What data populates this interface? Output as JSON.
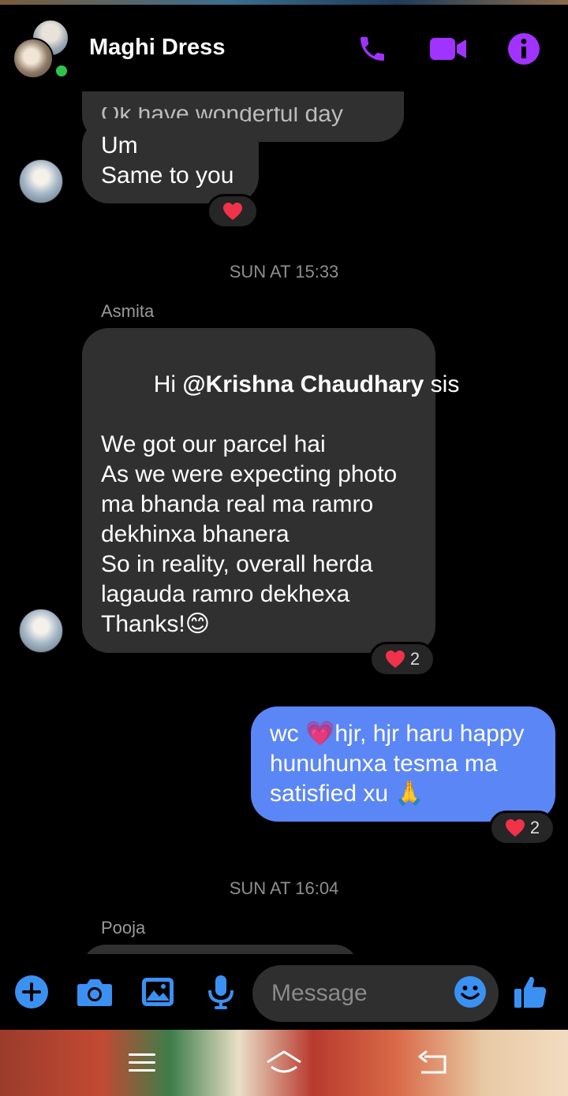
{
  "header": {
    "title": "Maghi Dress",
    "icons": [
      "phone-icon",
      "video-camera-icon",
      "info-icon"
    ],
    "accent_color": "#a033ff"
  },
  "messages": {
    "partial_previous": "Ok have wonderful day",
    "reply1": {
      "lines": [
        "Um",
        "Same to you"
      ],
      "reaction_count": ""
    },
    "timestamp1": "SUN AT 15:33",
    "sender1": "Asmita",
    "msg2": {
      "line1_prefix": "Hi ",
      "mention": "@Krishna Chaudhary",
      "line1_suffix": " sis",
      "lines": [
        "We got our parcel hai",
        "",
        "As we were expecting photo",
        "ma bhanda real ma ramro",
        "dekhinxa bhanera",
        "So in reality, overall herda",
        "lagauda ramro dekhexa",
        "",
        "Thanks!😊"
      ],
      "reaction_count": "2"
    },
    "out1": {
      "lines": [
        "wc 💗hjr, hjr haru happy",
        "hunuhunxa tesma ma",
        "satisfied xu 🙏"
      ],
      "reaction_count": "2"
    },
    "timestamp2": "SUN AT 16:04",
    "sender2": "Pooja"
  },
  "composer": {
    "placeholder": "Message",
    "icons": [
      "plus-icon",
      "camera-icon",
      "gallery-icon",
      "microphone-icon",
      "emoji-icon",
      "thumbs-up-icon"
    ],
    "icon_color": "#3b91f2"
  },
  "colors": {
    "outgoing_bubble": "#5b86f5",
    "incoming_bubble": "#303030",
    "online": "#31c24a",
    "heart": "#f0324a"
  }
}
